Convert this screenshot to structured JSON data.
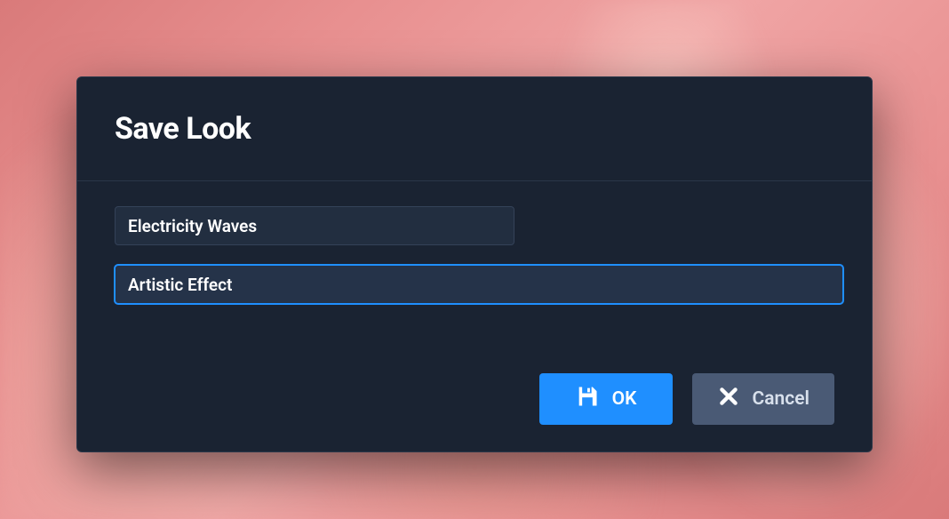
{
  "dialog": {
    "title": "Save Look",
    "fields": {
      "name": "Electricity Waves",
      "category": "Artistic Effect"
    },
    "buttons": {
      "ok": "OK",
      "cancel": "Cancel"
    }
  }
}
